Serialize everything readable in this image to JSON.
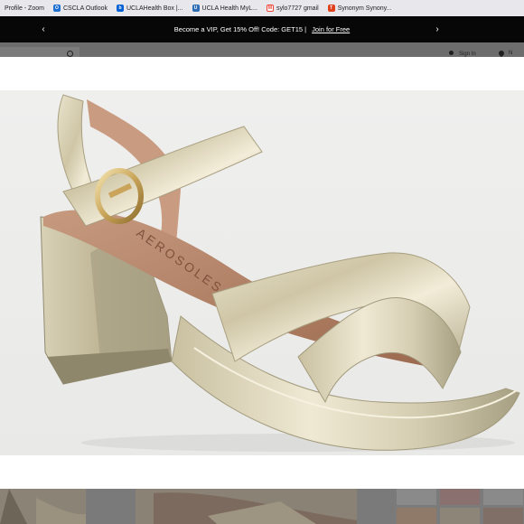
{
  "bookmarks": [
    {
      "label": "Profile - Zoom",
      "icon": "zoom-icon",
      "color": ""
    },
    {
      "label": "CSCLA Outlook",
      "icon": "outlook-icon",
      "color": "#1d6fd1"
    },
    {
      "label": "UCLAHealth Box |...",
      "icon": "box-icon",
      "color": "#0061d5"
    },
    {
      "label": "UCLA Health MyL...",
      "icon": "ucla-icon",
      "color": "#2e6db4"
    },
    {
      "label": "sylo7727 gmail",
      "icon": "gmail-icon",
      "color": "#ea4335"
    },
    {
      "label": "Synonym Synony...",
      "icon": "thesaurus-icon",
      "color": "#e2411e"
    }
  ],
  "promo": {
    "text": "Become a VIP, Get 15% Off! Code: GET15 |",
    "link": "Join for Free",
    "prev_arrow": "‹",
    "next_arrow": "›"
  },
  "header": {
    "signin_label": "Sign In",
    "cut_label": "N"
  },
  "product": {
    "brand_on_insole": "AEROSOLES",
    "colors": {
      "metal": "#d9d2b8",
      "insole": "#b07a5c",
      "background": "#ececea"
    }
  }
}
